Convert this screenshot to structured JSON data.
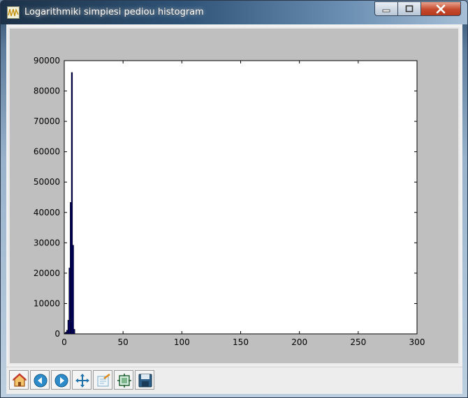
{
  "window": {
    "title": "Logarithmiki simpiesi pediou histogram",
    "app_icon": "matplotlib-figure-icon"
  },
  "window_controls": [
    {
      "name": "minimize-button",
      "icon": "minimize-icon"
    },
    {
      "name": "maximize-button",
      "icon": "maximize-icon"
    },
    {
      "name": "close-button",
      "icon": "close-icon"
    }
  ],
  "toolbar": {
    "buttons": [
      {
        "name": "home-button",
        "icon": "home-icon"
      },
      {
        "name": "back-button",
        "icon": "back-arrow-icon"
      },
      {
        "name": "forward-button",
        "icon": "forward-arrow-icon"
      },
      {
        "name": "pan-button",
        "icon": "pan-arrows-icon"
      },
      {
        "name": "zoom-button",
        "icon": "zoom-rect-icon"
      },
      {
        "name": "subplots-button",
        "icon": "subplots-icon"
      },
      {
        "name": "save-button",
        "icon": "floppy-disk-icon"
      }
    ]
  },
  "colors": {
    "bar_fill": "#000080",
    "figure_bg": "#bfbfbf",
    "axes_bg": "#ffffff"
  },
  "chart_data": {
    "type": "bar",
    "title": "",
    "xlabel": "",
    "ylabel": "",
    "xlim": [
      0,
      300
    ],
    "ylim": [
      0,
      90000
    ],
    "xticks": [
      "0",
      "50",
      "100",
      "150",
      "200",
      "250",
      "300"
    ],
    "yticks": [
      "0",
      "10000",
      "20000",
      "30000",
      "40000",
      "50000",
      "60000",
      "70000",
      "80000",
      "90000"
    ],
    "bin_width": 1,
    "bins": [
      {
        "x": 0,
        "value": 300
      },
      {
        "x": 1,
        "value": 600
      },
      {
        "x": 2,
        "value": 1200
      },
      {
        "x": 3,
        "value": 4500
      },
      {
        "x": 4,
        "value": 21700
      },
      {
        "x": 5,
        "value": 43300
      },
      {
        "x": 6,
        "value": 86100
      },
      {
        "x": 7,
        "value": 29200
      },
      {
        "x": 8,
        "value": 1500
      }
    ],
    "grid": false,
    "legend": "none"
  }
}
